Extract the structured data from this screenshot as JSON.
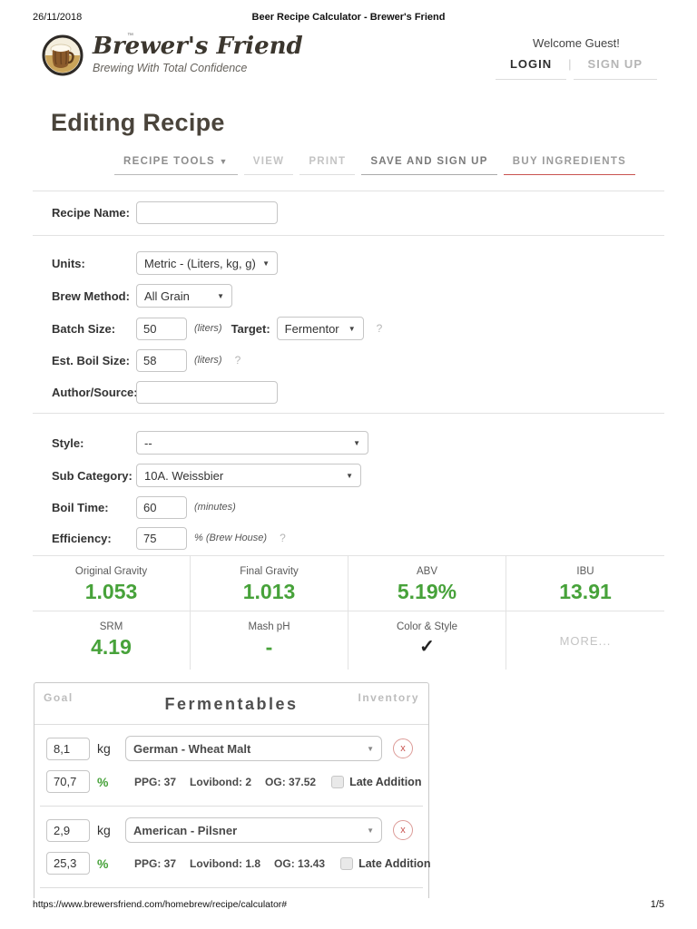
{
  "print_header": {
    "date": "26/11/2018",
    "title": "Beer Recipe Calculator - Brewer's Friend",
    "url": "https://www.brewersfriend.com/homebrew/recipe/calculator#",
    "page_number": "1/5"
  },
  "site_header": {
    "logo_name": "Brewer's Friend",
    "tagline": "Brewing With Total Confidence",
    "welcome": "Welcome Guest!",
    "login_label": "LOGIN",
    "separator": "|",
    "signup_label": "SIGN UP"
  },
  "page_title": "Editing Recipe",
  "tabs": {
    "recipe_tools": "RECIPE TOOLS",
    "view": "VIEW",
    "print": "PRINT",
    "save": "SAVE AND SIGN UP",
    "buy": "BUY INGREDIENTS"
  },
  "icons": {
    "dropdown_arrow": "▼",
    "dropdown_arrow_small": "▼",
    "help": "?",
    "check": "✓",
    "remove": "x",
    "trademark": "™"
  },
  "form": {
    "recipe_name": {
      "label": "Recipe Name:",
      "value": ""
    },
    "units": {
      "label": "Units:",
      "value": "Metric - (Liters, kg, g)"
    },
    "brew_method": {
      "label": "Brew Method:",
      "value": "All Grain"
    },
    "batch_size": {
      "label": "Batch Size:",
      "value": "50",
      "unit": "(liters)",
      "target_label": "Target:",
      "target_value": "Fermentor"
    },
    "boil_size": {
      "label": "Est. Boil Size:",
      "value": "58",
      "unit": "(liters)"
    },
    "author": {
      "label": "Author/Source:",
      "value": ""
    },
    "style": {
      "label": "Style:",
      "value": "--"
    },
    "sub_category": {
      "label": "Sub Category:",
      "value": "10A. Weissbier"
    },
    "boil_time": {
      "label": "Boil Time:",
      "value": "60",
      "unit": "(minutes)"
    },
    "efficiency": {
      "label": "Efficiency:",
      "value": "75",
      "unit": "% (Brew House)"
    }
  },
  "stats": {
    "og": {
      "label": "Original Gravity",
      "value": "1.053"
    },
    "fg": {
      "label": "Final Gravity",
      "value": "1.013"
    },
    "abv": {
      "label": "ABV",
      "value": "5.19%"
    },
    "ibu": {
      "label": "IBU",
      "value": "13.91"
    },
    "srm": {
      "label": "SRM",
      "value": "4.19"
    },
    "mash_ph": {
      "label": "Mash pH",
      "value": "-"
    },
    "color_style": {
      "label": "Color & Style",
      "value": "✓"
    },
    "more_label": "MORE..."
  },
  "fermentables": {
    "goal_label": "Goal",
    "title": "Fermentables",
    "inventory_label": "Inventory",
    "rows": [
      {
        "amount": "8,1",
        "amount_unit": "kg",
        "name": "German - Wheat Malt",
        "percent": "70,7",
        "percent_unit": "%",
        "ppg": "PPG: 37",
        "lovibond": "Lovibond: 2",
        "og": "OG: 37.52",
        "late_addition_label": "Late Addition"
      },
      {
        "amount": "2,9",
        "amount_unit": "kg",
        "name": "American - Pilsner",
        "percent": "25,3",
        "percent_unit": "%",
        "ppg": "PPG: 37",
        "lovibond": "Lovibond: 1.8",
        "og": "OG: 13.43",
        "late_addition_label": "Late Addition"
      }
    ]
  },
  "colors": {
    "stat_green": "#47a23a",
    "buy_underline_red": "#c9534f"
  }
}
